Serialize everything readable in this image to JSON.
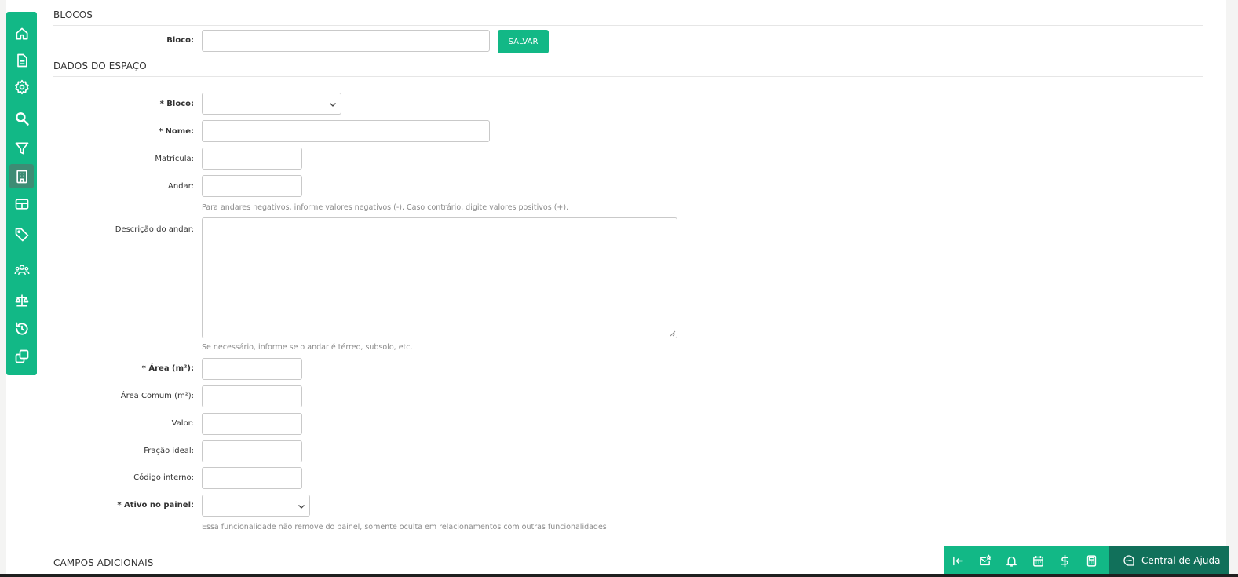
{
  "colors": {
    "accent": "#12b886",
    "accent_dark": "#11705a",
    "active_item": "#3d8c74"
  },
  "sidebar": {
    "items": [
      {
        "icon": "home-icon"
      },
      {
        "icon": "document-icon"
      },
      {
        "icon": "gear-icon"
      },
      {
        "icon": "search-icon"
      },
      {
        "icon": "filter-icon"
      },
      {
        "icon": "building-icon",
        "active": true
      },
      {
        "icon": "table-icon"
      },
      {
        "icon": "tag-icon"
      },
      {
        "icon": "users-icon"
      },
      {
        "icon": "scale-icon"
      },
      {
        "icon": "history-icon"
      },
      {
        "icon": "copy-icon"
      }
    ]
  },
  "blocos": {
    "title": "BLOCOS",
    "bloco_label": "Bloco:",
    "bloco_value": "",
    "save_label": "SALVAR"
  },
  "dados": {
    "title": "DADOS DO ESPAÇO",
    "bloco_label": "* Bloco:",
    "bloco_value": "",
    "nome_label": "* Nome:",
    "nome_value": "",
    "matricula_label": "Matrícula:",
    "matricula_value": "",
    "andar_label": "Andar:",
    "andar_value": "",
    "andar_help": "Para andares negativos, informe valores negativos (-). Caso contrário, digite valores positivos (+).",
    "descricao_label": "Descrição do andar:",
    "descricao_value": "",
    "descricao_help": "Se necessário, informe se o andar é térreo, subsolo, etc.",
    "area_label": "* Área (m²):",
    "area_value": "",
    "area_comum_label": "Área Comum (m²):",
    "area_comum_value": "",
    "valor_label": "Valor:",
    "valor_value": "",
    "fracao_label": "Fração ideal:",
    "fracao_value": "",
    "codigo_label": "Código interno:",
    "codigo_value": "",
    "ativo_label": "* Ativo no painel:",
    "ativo_value": "",
    "ativo_help": "Essa funcionalidade não remove do painel, somente oculta em relacionamentos com outras funcionalidades"
  },
  "campos": {
    "title": "CAMPOS ADICIONAIS"
  },
  "bottom_bar": {
    "items": [
      {
        "icon": "collapse-left-icon"
      },
      {
        "icon": "mail-star-icon"
      },
      {
        "icon": "bell-icon"
      },
      {
        "icon": "calendar-icon"
      },
      {
        "icon": "dollar-icon"
      },
      {
        "icon": "calculator-icon"
      }
    ],
    "help_center_label": "Central de Ajuda",
    "help_center_icon": "chat-icon"
  }
}
